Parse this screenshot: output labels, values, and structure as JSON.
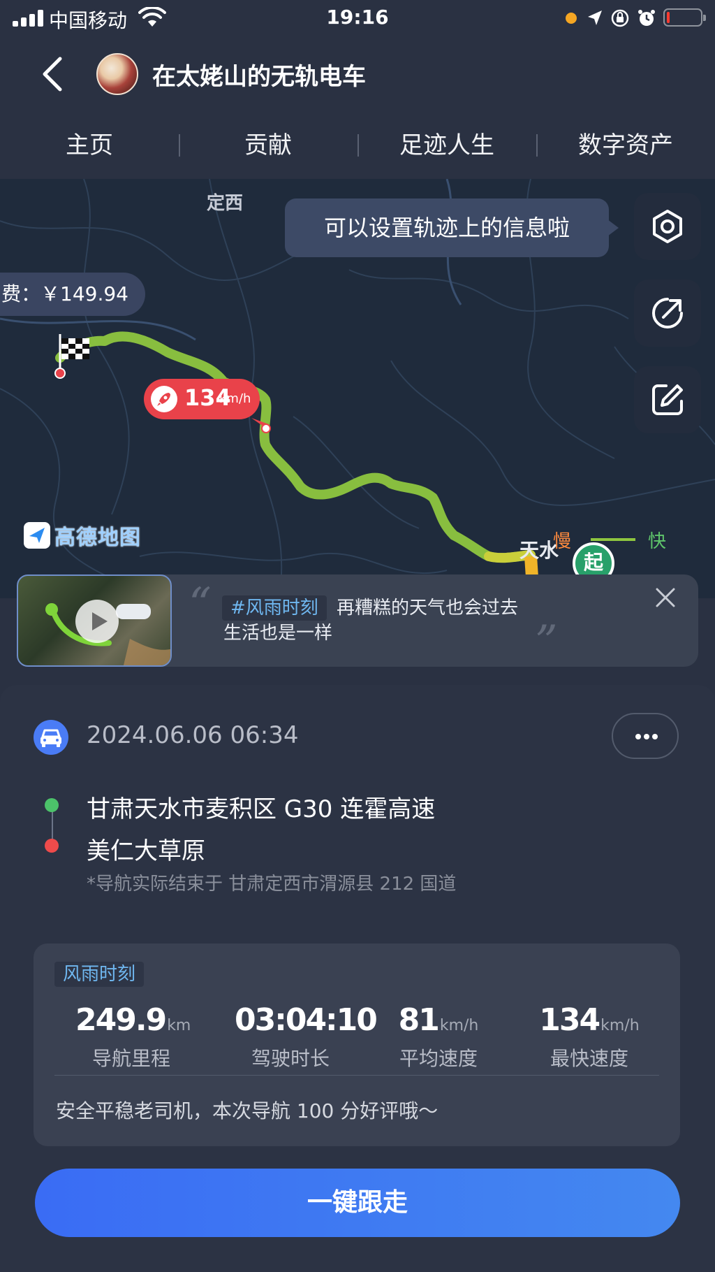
{
  "status_bar": {
    "carrier": "中国移动",
    "time": "19:16",
    "battery_level": 0.05,
    "icons": [
      "signal-icon",
      "wifi-icon",
      "location-arrow-icon",
      "orientation-lock-icon",
      "alarm-icon",
      "battery-icon"
    ]
  },
  "header": {
    "title": "在太姥山的无轨电车",
    "back_icon": "chevron-left-icon"
  },
  "tabs": [
    {
      "label": "主页"
    },
    {
      "label": "贡献"
    },
    {
      "label": "足迹人生"
    },
    {
      "label": "数字资产"
    }
  ],
  "map": {
    "place_labels": {
      "dingxi": "定西",
      "tianshui": "天水"
    },
    "tooltip": "可以设置轨迹上的信息啦",
    "cost_text": "费：￥149.94",
    "speed_badge": {
      "value": "134",
      "unit": "km/h"
    },
    "legend": {
      "slow": "慢",
      "fast": "快"
    },
    "start_marker": "起",
    "logo_text": "高德地图",
    "buttons": [
      "settings-icon",
      "share-icon",
      "edit-icon"
    ],
    "colors": {
      "route_fast": "#8ec63f",
      "route_slow": "#f0b429",
      "start": "#28a06a",
      "end": "#e9424a"
    }
  },
  "story": {
    "tag": "#风雨时刻",
    "line1": "再糟糕的天气也会过去",
    "line2": "生活也是一样"
  },
  "trip": {
    "date": "2024.06.06 06:34",
    "start": "甘肃天水市麦积区 G30 连霍高速",
    "end": "美仁大草原",
    "note": "*导航实际结束于 甘肃定西市渭源县 212 国道"
  },
  "stats": {
    "tag": "风雨时刻",
    "items": [
      {
        "value": "249.9",
        "unit": "km",
        "label": "导航里程"
      },
      {
        "value": "03:04:10",
        "unit": "",
        "label": "驾驶时长"
      },
      {
        "value": "81",
        "unit": "km/h",
        "label": "平均速度"
      },
      {
        "value": "134",
        "unit": "km/h",
        "label": "最快速度"
      }
    ],
    "comment": "安全平稳老司机，本次导航 100 分好评哦～"
  },
  "actions": {
    "follow_label": "一键跟走"
  }
}
